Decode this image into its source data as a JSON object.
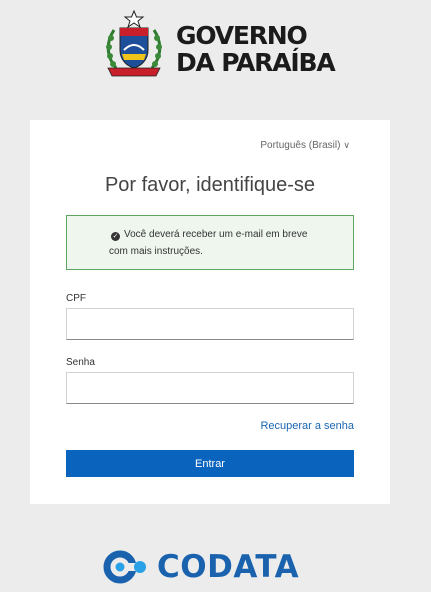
{
  "header": {
    "logo_line1": "GOVERNO",
    "logo_line2": "DA PARAÍBA"
  },
  "language": {
    "selected": "Português (Brasil)",
    "chevron": "∨"
  },
  "login": {
    "title": "Por favor, identifique-se",
    "alert_line1": "Você deverá receber um e-mail em breve",
    "alert_line2": "com mais instruções.",
    "cpf_label": "CPF",
    "cpf_value": "",
    "password_label": "Senha",
    "password_value": "",
    "recover_link": "Recuperar a senha",
    "submit_label": "Entrar"
  },
  "footer": {
    "logo_text": "CODATA"
  },
  "colors": {
    "background": "#ececec",
    "primary_button": "#0a64be",
    "link": "#1a66b3",
    "alert_border": "#5fa55f",
    "alert_background": "#eef6ee",
    "codata_blue": "#1a62ad"
  },
  "icons": {
    "alert": "check-circle-icon",
    "language": "chevron-down-icon",
    "header": "paraiba-coat-of-arms",
    "footer": "codata-logo-mark"
  }
}
